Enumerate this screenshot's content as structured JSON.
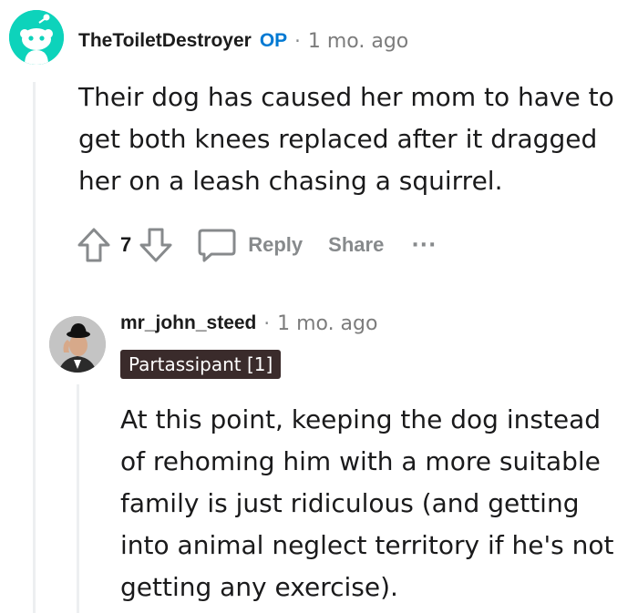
{
  "comment": {
    "author": "TheToiletDestroyer",
    "op_badge": "OP",
    "separator": "·",
    "time": "1 mo. ago",
    "body": "Their dog has caused her mom to have to get both knees replaced after it dragged her on a leash chasing a squirrel.",
    "votes": "7",
    "reply_label": "Reply",
    "share_label": "Share",
    "more_label": "···",
    "avatar_color": "#0dd3bb"
  },
  "reply": {
    "author": "mr_john_steed",
    "separator": "·",
    "time": "1 mo. ago",
    "flair": "Partassipant [1]",
    "flair_color": "#3a2b2b",
    "body": "At this point, keeping the dog instead of rehoming him with a more suitable family is just ridiculous (and getting into animal neglect territory if he's not getting any exercise)."
  },
  "colors": {
    "op_accent": "#0079d3",
    "meta_gray": "#878a8c",
    "thread_line": "#edeff1"
  }
}
